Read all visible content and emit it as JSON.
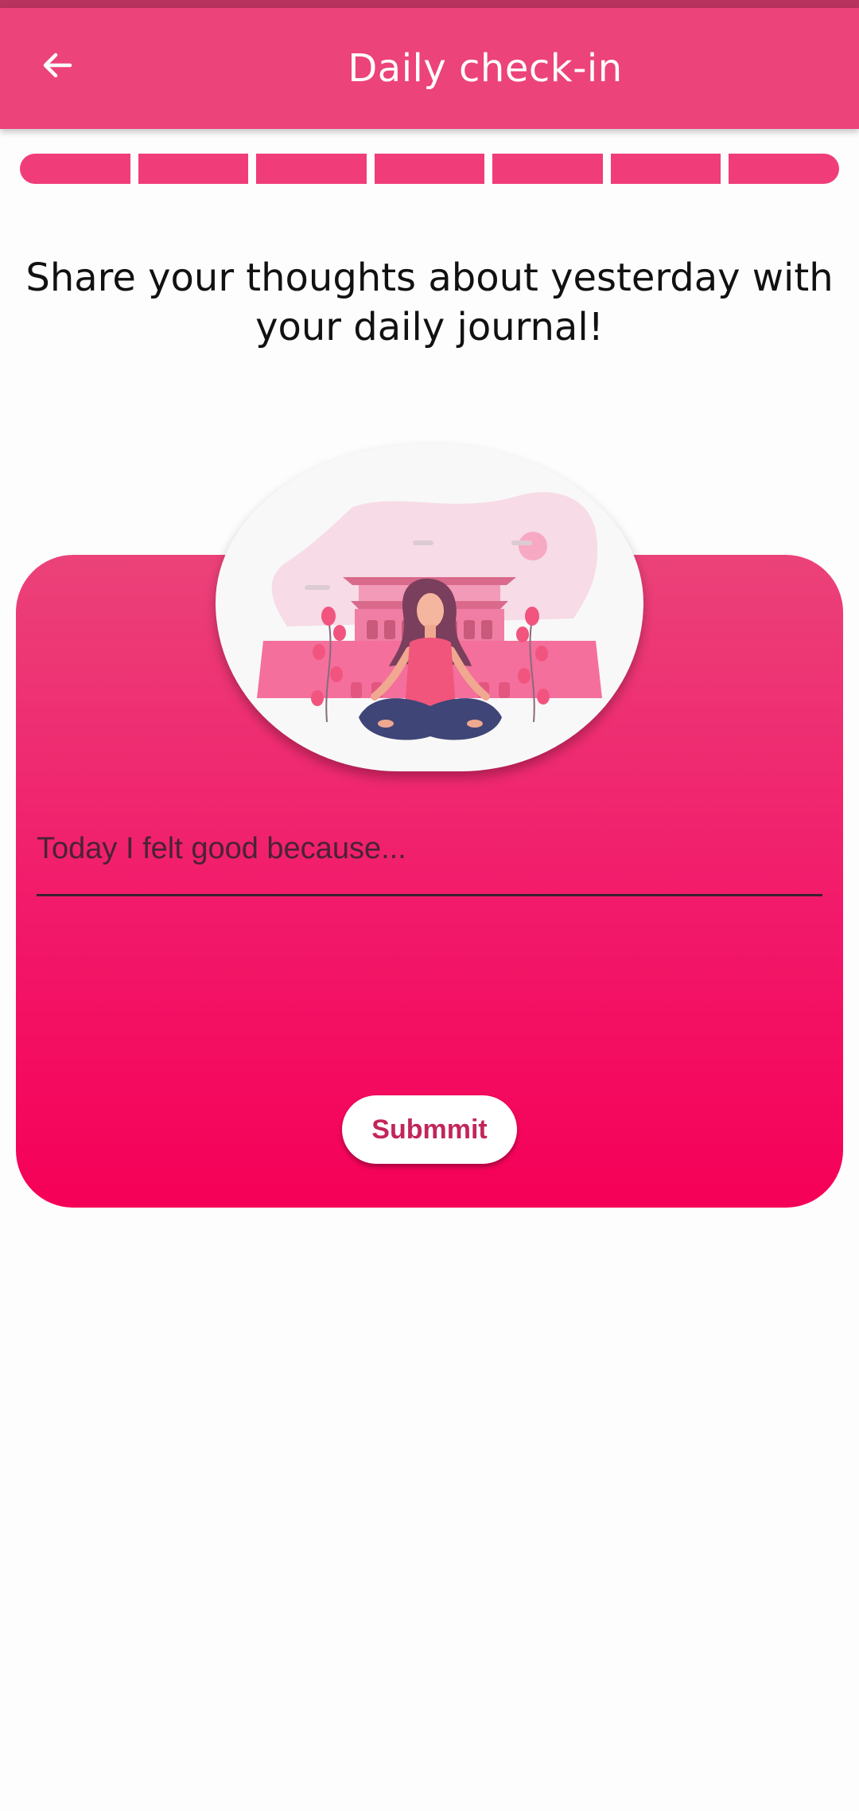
{
  "app_bar": {
    "title": "Daily check-in",
    "back_icon": "arrow-left-icon",
    "color": "#ec437a"
  },
  "progress": {
    "segments_total": 7,
    "segments_complete": 7,
    "color": "#f03d7a"
  },
  "prompt": {
    "text": "Share your thoughts about yesterday with your daily journal!"
  },
  "card": {
    "illustration": "meditation-illustration",
    "gradient_top": "#eb4279",
    "gradient_bottom": "#f50057"
  },
  "journal": {
    "value": "",
    "placeholder": "Today I felt good because..."
  },
  "submit": {
    "label": "Submmit"
  }
}
